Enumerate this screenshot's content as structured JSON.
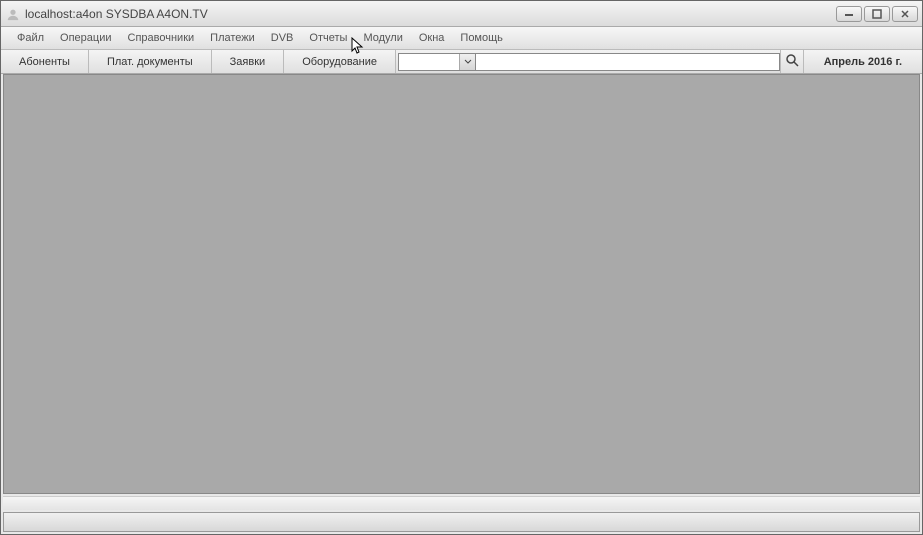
{
  "window": {
    "title": "localhost:a4on SYSDBA A4ON.TV"
  },
  "menu": {
    "items": [
      "Файл",
      "Операции",
      "Справочники",
      "Платежи",
      "DVB",
      "Отчеты",
      "Модули",
      "Окна",
      "Помощь"
    ]
  },
  "toolbar": {
    "tabs": [
      "Абоненты",
      "Плат. документы",
      "Заявки",
      "Оборудование"
    ],
    "combo_value": "",
    "search_value": "",
    "date_label": "Апрель 2016 г."
  },
  "status": ""
}
